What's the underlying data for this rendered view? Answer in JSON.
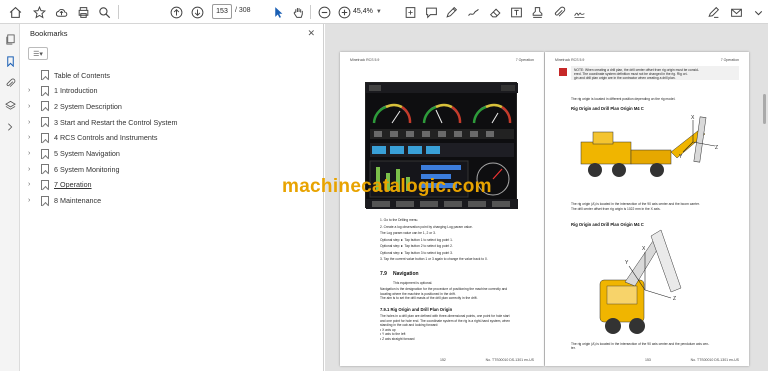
{
  "toolbar": {
    "page_current": "153",
    "page_total": "/ 308",
    "zoom_value": "45,4%"
  },
  "bookmarks": {
    "title": "Bookmarks",
    "items": [
      {
        "label": "Table of Contents",
        "expandable": false,
        "current": false
      },
      {
        "label": "1 Introduction",
        "expandable": true,
        "current": false
      },
      {
        "label": "2 System Description",
        "expandable": true,
        "current": false
      },
      {
        "label": "3 Start and Restart the Control System",
        "expandable": true,
        "current": false
      },
      {
        "label": "4 RCS Controls and Instruments",
        "expandable": true,
        "current": false
      },
      {
        "label": "5 System Navigation",
        "expandable": true,
        "current": false
      },
      {
        "label": "6 System Monitoring",
        "expandable": true,
        "current": false
      },
      {
        "label": "7 Operation",
        "expandable": true,
        "current": true
      },
      {
        "label": "8 Maintenance",
        "expandable": true,
        "current": false
      }
    ]
  },
  "document": {
    "left_page": {
      "header_left": "Minetruck RCS 5.9",
      "header_right": "7 Operation",
      "steps": [
        "1.   Go to the Drilling menu.",
        "2.   Create a log observation point by changing Log param value.",
        "      The Log param value can be 1, 2 or 3.",
        "Optional step   ►  Tap button 1 to select log point 1.",
        "Optional step   ►  Tap button 2 to select log point 2.",
        "Optional step   ►  Tap button 3 to select log point 3.",
        "3.   Tap the current value button 1 or 3 again to change the value back to 0."
      ],
      "section_num": "7.9",
      "section_title": "Navigation",
      "section_sub": "This equipment is optional.",
      "section_body": [
        "Navigation is the designation for the procedure of positioning the machine correctly and",
        "locating where the machine is positioned in the drift.",
        "The aim is to set the drill masts of the drill plan correctly in the drift."
      ],
      "subsection_title": "7.9.1 Rig Origin and Drill Plan Origin",
      "subsection_body": [
        "The holes in a drill plan are defined with three-dimensional points, one point for hole start",
        "and one point for hole end. The coordinate system of the rig is a right-hand system, when",
        "standing in the cab and looking forward:",
        "•   X axis up",
        "•   Y axis to the left",
        "•   Z axis straight forward"
      ],
      "footer_left": "152",
      "footer_right": "No. TTS00010 DS-1301 en-US"
    },
    "right_page": {
      "header_left": "Minetruck RCS 5.9",
      "header_right": "7 Operation",
      "note": [
        "NOTE: When creating a drill plan, the drill center offset from rig origin must be consid-",
        "ered. The coordinate system definition must not be changed in the rig. Rig ori-",
        "gin and drill plan origin are in the contractor when creating a drill plan."
      ],
      "para1": "The rig origin is located in different position depending on the rig model.",
      "fig1_title": "Rig Origin and Drill Plan Origin M4 C",
      "fig1_caption": [
        "The rig origin (A) is located in the intersection of the 90 axis center and the boom carrier.",
        "The drill center offset from rig origin is 1022 mm in the X axis."
      ],
      "fig2_title": "Rig Origin and Drill Plan Origin M4 C",
      "fig2_caption": "The rig origin (A) is located in the intersection of the 90 axis center and the pendulum axis cen-",
      "fig2_caption2": "ter.",
      "footer_left": "153",
      "footer_right": "No. TTS00010 DS-1301 en-US"
    }
  },
  "watermark": "machinecatalogic.com",
  "colors": {
    "watermark": "#e8a300",
    "machine_yellow": "#f0b500",
    "viewer_bg": "#e1e1e1"
  }
}
